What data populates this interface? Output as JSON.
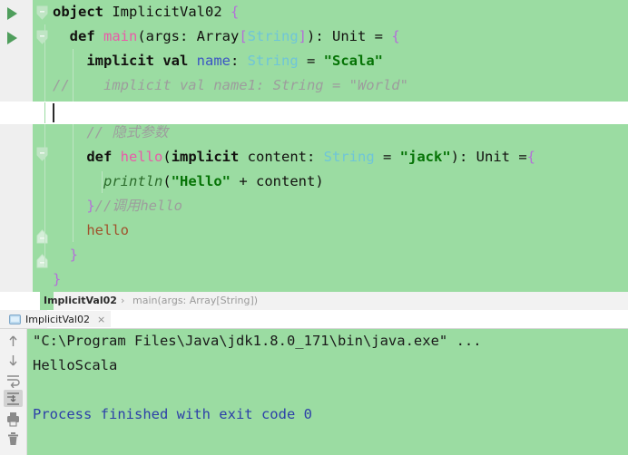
{
  "editor": {
    "background_color": "#9bdca2",
    "gutter_color": "#efefef",
    "run_markers": [
      "run-icon",
      "run-icon"
    ],
    "lines": [
      {
        "id": "line-1",
        "tokens": [
          {
            "cls": "kw",
            "text": "object"
          },
          {
            "cls": "plain",
            "text": " ImplicitVal02 "
          },
          {
            "cls": "brace",
            "text": "{"
          }
        ]
      },
      {
        "id": "line-2",
        "tokens": [
          {
            "cls": "plain",
            "text": "  "
          },
          {
            "cls": "kw",
            "text": "def"
          },
          {
            "cls": "plain",
            "text": " "
          },
          {
            "cls": "meth",
            "text": "main"
          },
          {
            "cls": "plain",
            "text": "(args: Array"
          },
          {
            "cls": "brk",
            "text": "["
          },
          {
            "cls": "type",
            "text": "String"
          },
          {
            "cls": "brk",
            "text": "]"
          },
          {
            "cls": "plain",
            "text": "): Unit = "
          },
          {
            "cls": "brace",
            "text": "{"
          }
        ]
      },
      {
        "id": "line-3",
        "tokens": [
          {
            "cls": "plain",
            "text": "    "
          },
          {
            "cls": "kw",
            "text": "implicit val"
          },
          {
            "cls": "plain",
            "text": " "
          },
          {
            "cls": "varn",
            "text": "name"
          },
          {
            "cls": "plain",
            "text": ": "
          },
          {
            "cls": "type",
            "text": "String"
          },
          {
            "cls": "plain",
            "text": " = "
          },
          {
            "cls": "str",
            "text": "\"Scala\""
          }
        ]
      },
      {
        "id": "line-4",
        "tokens": [
          {
            "cls": "cmt",
            "text": "//    implicit val name1: String = \"World\""
          }
        ]
      },
      {
        "id": "line-5-blank",
        "blank": true,
        "tokens": []
      },
      {
        "id": "line-6",
        "tokens": [
          {
            "cls": "plain",
            "text": "    "
          },
          {
            "cls": "cmt",
            "text": "// 隐式参数"
          }
        ]
      },
      {
        "id": "line-7",
        "tokens": [
          {
            "cls": "plain",
            "text": "    "
          },
          {
            "cls": "kw",
            "text": "def"
          },
          {
            "cls": "plain",
            "text": " "
          },
          {
            "cls": "meth",
            "text": "hello"
          },
          {
            "cls": "plain",
            "text": "("
          },
          {
            "cls": "kw",
            "text": "implicit"
          },
          {
            "cls": "plain",
            "text": " content: "
          },
          {
            "cls": "type",
            "text": "String"
          },
          {
            "cls": "plain",
            "text": " = "
          },
          {
            "cls": "str",
            "text": "\"jack\""
          },
          {
            "cls": "plain",
            "text": "): Unit ="
          },
          {
            "cls": "brace",
            "text": "{"
          }
        ]
      },
      {
        "id": "line-8",
        "tokens": [
          {
            "cls": "plain",
            "text": "      "
          },
          {
            "cls": "itfn",
            "text": "println"
          },
          {
            "cls": "plain",
            "text": "("
          },
          {
            "cls": "str",
            "text": "\"Hello\""
          },
          {
            "cls": "plain",
            "text": " + content)"
          }
        ]
      },
      {
        "id": "line-9",
        "tokens": [
          {
            "cls": "plain",
            "text": "    "
          },
          {
            "cls": "brace",
            "text": "}"
          },
          {
            "cls": "cmt",
            "text": "//调用hello"
          }
        ]
      },
      {
        "id": "line-10",
        "tokens": [
          {
            "cls": "plain",
            "text": "    "
          },
          {
            "cls": "call",
            "text": "hello"
          }
        ]
      },
      {
        "id": "line-11",
        "tokens": [
          {
            "cls": "plain",
            "text": "  "
          },
          {
            "cls": "brace",
            "text": "}"
          }
        ]
      },
      {
        "id": "line-12",
        "tokens": [
          {
            "cls": "brace",
            "text": "}"
          }
        ]
      }
    ]
  },
  "breadcrumb": {
    "class_name": "ImplicitVal02",
    "separator": "›",
    "method_name": "main(args: Array[String])"
  },
  "run_tab": {
    "label": "ImplicitVal02",
    "close_label": "×",
    "icon": "console-icon"
  },
  "console": {
    "toolbar_icons": [
      {
        "name": "arrow-up-icon",
        "selected": false
      },
      {
        "name": "arrow-down-icon",
        "selected": false
      },
      {
        "name": "soft-wrap-icon",
        "selected": false
      },
      {
        "name": "scroll-to-end-icon",
        "selected": true
      },
      {
        "name": "print-icon",
        "selected": false
      },
      {
        "name": "trash-icon",
        "selected": false
      }
    ],
    "lines": [
      {
        "id": "console-line-command",
        "cls": "c-dark",
        "text": "\"C:\\Program Files\\Java\\jdk1.8.0_171\\bin\\java.exe\" ..."
      },
      {
        "id": "console-line-output",
        "cls": "c-dark",
        "text": "HelloScala"
      },
      {
        "id": "console-line-spacer",
        "cls": "c-dark",
        "text": " "
      },
      {
        "id": "console-line-exit",
        "cls": "c-blue",
        "text": "Process finished with exit code 0"
      }
    ]
  }
}
